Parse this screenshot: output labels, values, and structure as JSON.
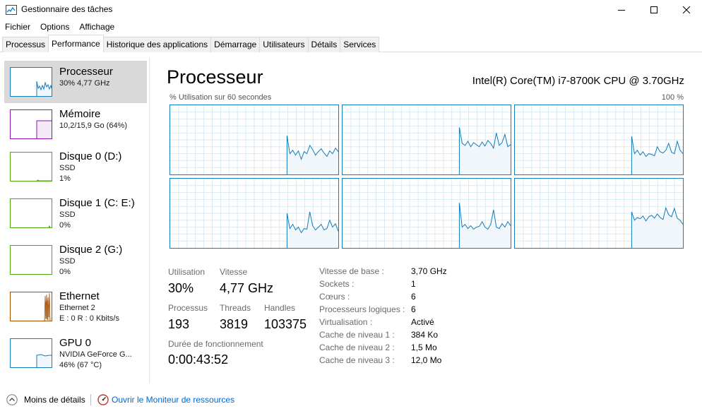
{
  "window": {
    "title": "Gestionnaire des tâches",
    "minimize_icon": "minimize-icon",
    "maximize_icon": "maximize-icon",
    "close_icon": "close-icon"
  },
  "menu": [
    "Fichier",
    "Options",
    "Affichage"
  ],
  "tabs": [
    {
      "label": "Processus",
      "active": false
    },
    {
      "label": "Performance",
      "active": true
    },
    {
      "label": "Historique des applications",
      "active": false
    },
    {
      "label": "Démarrage",
      "active": false
    },
    {
      "label": "Utilisateurs",
      "active": false
    },
    {
      "label": "Détails",
      "active": false
    },
    {
      "label": "Services",
      "active": false
    }
  ],
  "sidebar": {
    "items": [
      {
        "title": "Processeur",
        "lines": [
          "30%  4,77 GHz"
        ],
        "color": "#117dbb",
        "selected": true
      },
      {
        "title": "Mémoire",
        "lines": [
          "10,2/15,9 Go (64%)"
        ],
        "color": "#8b12ae",
        "selected": false
      },
      {
        "title": "Disque 0 (D:)",
        "lines": [
          "SSD",
          "1%"
        ],
        "color": "#4da60c",
        "selected": false
      },
      {
        "title": "Disque 1 (C: E:)",
        "lines": [
          "SSD",
          "0%"
        ],
        "color": "#4da60c",
        "selected": false
      },
      {
        "title": "Disque 2 (G:)",
        "lines": [
          "SSD",
          "0%"
        ],
        "color": "#4da60c",
        "selected": false
      },
      {
        "title": "Ethernet",
        "lines": [
          "Ethernet 2",
          "E : 0  R : 0 Kbits/s"
        ],
        "color": "#a74f01",
        "selected": false
      },
      {
        "title": "GPU 0",
        "lines": [
          "NVIDIA GeForce G...",
          "46% (67 °C)"
        ],
        "color": "#117dbb",
        "selected": false
      }
    ]
  },
  "main": {
    "title": "Processeur",
    "cpu_model": "Intel(R) Core(TM) i7-8700K CPU @ 3.70GHz",
    "graph_caption": "% Utilisation sur 60 secondes",
    "graph_max": "100 %",
    "graph_color": "#117dbb",
    "core_count_graphs": 6,
    "stats": {
      "utilisation_label": "Utilisation",
      "utilisation_value": "30%",
      "vitesse_label": "Vitesse",
      "vitesse_value": "4,77 GHz",
      "processus_label": "Processus",
      "processus_value": "193",
      "threads_label": "Threads",
      "threads_value": "3819",
      "handles_label": "Handles",
      "handles_value": "103375",
      "uptime_label": "Durée de fonctionnement",
      "uptime_value": "0:00:43:52"
    },
    "details": [
      {
        "label": "Vitesse de base :",
        "value": "3,70 GHz"
      },
      {
        "label": "Sockets :",
        "value": "1"
      },
      {
        "label": "Cœurs :",
        "value": "6"
      },
      {
        "label": "Processeurs logiques :",
        "value": "6"
      },
      {
        "label": "Virtualisation :",
        "value": "Activé"
      },
      {
        "label": "Cache de niveau 1 :",
        "value": "384 Ko"
      },
      {
        "label": "Cache de niveau 2 :",
        "value": "1,5 Mo"
      },
      {
        "label": "Cache de niveau 3 :",
        "value": "12,0 Mo"
      }
    ]
  },
  "footer": {
    "less_details": "Moins de détails",
    "resource_monitor": "Ouvrir le Moniteur de ressources"
  }
}
